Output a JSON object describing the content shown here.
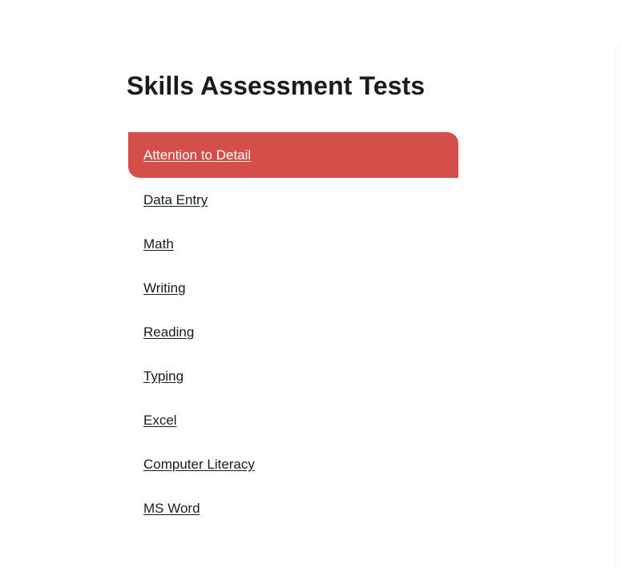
{
  "page": {
    "title": "Skills Assessment Tests",
    "background_color": "#ffffff"
  },
  "theme": {
    "accent_color": "#d44f4a",
    "text_color": "#1b1b1b",
    "active_text_color": "#ffffff",
    "divider_color": "#f4f4f4"
  },
  "test_list": {
    "items": [
      {
        "label": "Attention to Detail",
        "active": true
      },
      {
        "label": "Data Entry",
        "active": false
      },
      {
        "label": "Math",
        "active": false
      },
      {
        "label": "Writing",
        "active": false
      },
      {
        "label": "Reading",
        "active": false
      },
      {
        "label": "Typing",
        "active": false
      },
      {
        "label": "Excel",
        "active": false
      },
      {
        "label": "Computer Literacy",
        "active": false
      },
      {
        "label": "MS Word",
        "active": false
      }
    ]
  }
}
